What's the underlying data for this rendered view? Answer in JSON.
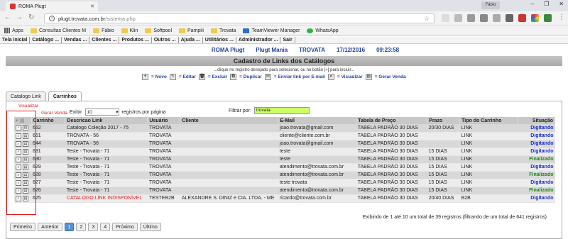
{
  "browser": {
    "tab_title": "ROMA Plugt",
    "profile": "Fábio",
    "url_host": "plugt.trovata.com.br",
    "url_path": "/sistema.php",
    "bookmarks": [
      "Apps",
      "Consultas Clientes M",
      "Fábio",
      "Klin",
      "Softpool",
      "Pampili",
      "Trovata",
      "TeamViewer Manager",
      "WhatsApp"
    ]
  },
  "menu": [
    "Tela inicial",
    "Catálogo ...",
    "Vendas ...",
    "Clientes ...",
    "Produtos ...",
    "Outros ...",
    "Ajuda ...",
    "Utilitários ...",
    "Administrador ...",
    "Sair"
  ],
  "header": {
    "brand1": "ROMA Plugt",
    "brand2": "Plugt Mania",
    "brand3": "TROVATA",
    "date": "17/12/2016",
    "time": "09:23:58"
  },
  "title": "Cadastro de Links dos Catálogos",
  "hint": "...clique no registro desejado para selecionar, ou no botão [+] para incluir...",
  "legend": [
    "= Novo",
    "= Editar",
    "= Excluir",
    "= Duplicar",
    "= Enviar link por E-mail",
    "= Visualizar",
    "= Gerar Venda"
  ],
  "tabs": [
    "Catalogo Link",
    "Carrinhos"
  ],
  "controls": {
    "show_prefix": "Exibir",
    "show_value": "10",
    "show_suffix": "registros por página",
    "filter_label": "Filtrar por:",
    "filter_value": "trovata"
  },
  "annotations": {
    "view": "Visualizar",
    "sale": "Gerar Venda"
  },
  "table": {
    "headers": [
      "Carrinho",
      "Descricao Link",
      "Usuário",
      "Cliente",
      "E-Mail",
      "Tabela de Preço",
      "Prazo",
      "Tipo do Carrinho",
      "Situação"
    ],
    "rows": [
      [
        "652",
        "Catalogo Coleção 2017 - 75",
        "TROVATA",
        "",
        "joao.trovata@gmail.com",
        "TABELA PADRÃO 30 DIAS",
        "20/30 DIAS",
        "LINK",
        "Digitando"
      ],
      [
        "651",
        "TROVATA - 56",
        "TROVATA",
        "",
        "cliente@cliente.com.br",
        "TABELA PADRÃO 30 DIAS",
        "",
        "LINK",
        "Digitando"
      ],
      [
        "644",
        "TROVATA - 56",
        "TROVATA",
        "",
        "joao.trovata@gmail.com",
        "TABELA PADRÃO 30 DIAS",
        "",
        "LINK",
        "Digitando"
      ],
      [
        "631",
        "Teste - Trovata - 71",
        "TROVATA",
        "",
        "teste",
        "TABELA PADRÃO 30 DIAS",
        "15 DIAS",
        "LINK",
        "Digitando"
      ],
      [
        "630",
        "Teste - Trovata - 71",
        "TROVATA",
        "",
        "teste",
        "TABELA PADRÃO 30 DIAS",
        "15 DIAS",
        "LINK",
        "Finalizado"
      ],
      [
        "629",
        "Teste - Trovata - 71",
        "TROVATA",
        "",
        "atendimento@trovata.com.br",
        "TABELA PADRÃO 30 DIAS",
        "15 DIAS",
        "LINK",
        "Digitando"
      ],
      [
        "628",
        "Teste - Trovata - 71",
        "TROVATA",
        "",
        "atendimento@trovata.com.br",
        "TABELA PADRÃO 30 DIAS",
        "15 DIAS",
        "LINK",
        "Finalizado"
      ],
      [
        "627",
        "Teste - Trovata - 71",
        "TROVATA",
        "",
        "teste trovata",
        "TABELA PADRÃO 30 DIAS",
        "15 DIAS",
        "LINK",
        "Digitando"
      ],
      [
        "626",
        "Teste - Trovata - 71",
        "TROVATA",
        "",
        "atendimento@trovata.com.br",
        "TABELA PADRÃO 30 DIAS",
        "15 DIAS",
        "LINK",
        "Finalizado"
      ],
      [
        "625",
        "CATALOGO LINK INDISPONÍVEL",
        "TESTEB2B",
        "ALEXANDRE S. DINIZ e CIA. LTDA. - ME",
        "ricardo@trovata.com.br",
        "TABELA PADRÃO 30 DIAS",
        "20/40 DIAS",
        "B2B",
        "Digitando"
      ]
    ]
  },
  "info": "Exibindo de 1 até 10 um total de 39 registros (filtrando de um total de 641 registros)",
  "pager": [
    "Primeiro",
    "Anterior",
    "1",
    "2",
    "3",
    "4",
    "Próximo",
    "Último"
  ],
  "colors": {
    "digitando": "#1a2fcc",
    "finalizado": "#1f8a1f",
    "unavailable": "#e31b1b",
    "filter_bg": "#ccff66",
    "annotation": "#e31b1b"
  }
}
